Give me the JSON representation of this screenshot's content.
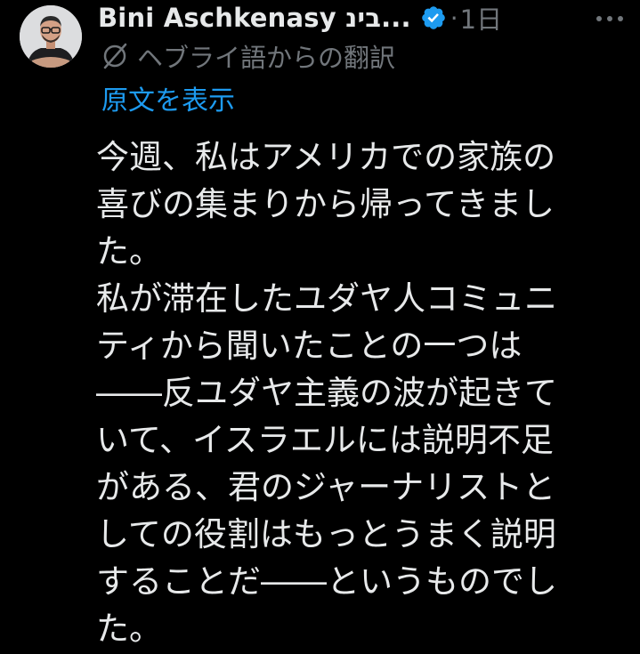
{
  "author": {
    "display_name": "Bini Aschkenasy בינ...",
    "verified": true
  },
  "meta": {
    "separator": "·",
    "timestamp": "1日"
  },
  "translation": {
    "notice": "ヘブライ語からの翻訳",
    "show_original": "原文を表示"
  },
  "tweet": {
    "lines": [
      "今週、私はアメリカでの家族の",
      "喜びの集まりから帰ってきまし",
      "た。",
      "私が滞在したユダヤ人コミュニ",
      "ティから聞いたことの一つは",
      "――反ユダヤ主義の波が起きて",
      "いて、イスラエルには説明不足",
      "がある、君のジャーナリストと",
      "しての役割はもっとうまく説明",
      "することだ――というものでし",
      "た。"
    ]
  },
  "colors": {
    "background": "#000000",
    "text_primary": "#e7e9ea",
    "text_secondary": "#71767b",
    "link": "#1d9bf0",
    "verified_badge": "#1d9bf0"
  },
  "icons": {
    "verified": "verified-badge-icon",
    "more": "more-options-icon",
    "translation": "globe-slash-icon"
  }
}
